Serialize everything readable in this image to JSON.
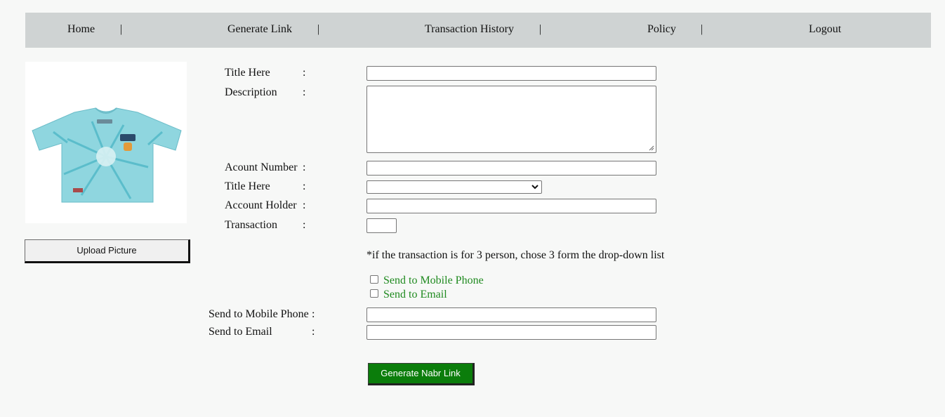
{
  "nav": {
    "items": [
      "Home",
      "Generate Link",
      "Transaction History",
      "Policy",
      "Logout"
    ],
    "separator": "|"
  },
  "sidebar": {
    "image_icon": "tshirt-image",
    "upload_label": "Upload Picture"
  },
  "form": {
    "colon": ":",
    "title_label": "Title Here",
    "title_value": "",
    "description_label": "Description",
    "description_value": "",
    "account_number_label": "Acount Number",
    "account_number_value": "",
    "title2_label": "Title Here",
    "title2_selected": "",
    "account_holder_label": "Account Holder",
    "account_holder_value": "",
    "transaction_label": "Transaction",
    "transaction_value": "",
    "note": "*if the transaction is for 3 person, chose 3 form the drop-down list",
    "check_mobile_label": "Send to Mobile Phone",
    "check_mobile_checked": false,
    "check_email_label": "Send to Email",
    "check_email_checked": false,
    "send_mobile_label": "Send to Mobile Phone",
    "send_mobile_value": "",
    "send_email_label": "Send to Email",
    "send_email_value": "",
    "generate_label": "Generate Nabr Link"
  },
  "colors": {
    "nav_bg": "#cfd3d3",
    "page_bg": "#f7f8f7",
    "checkbox_label": "#1f8a1f",
    "generate_button": "#0b7d0b"
  }
}
